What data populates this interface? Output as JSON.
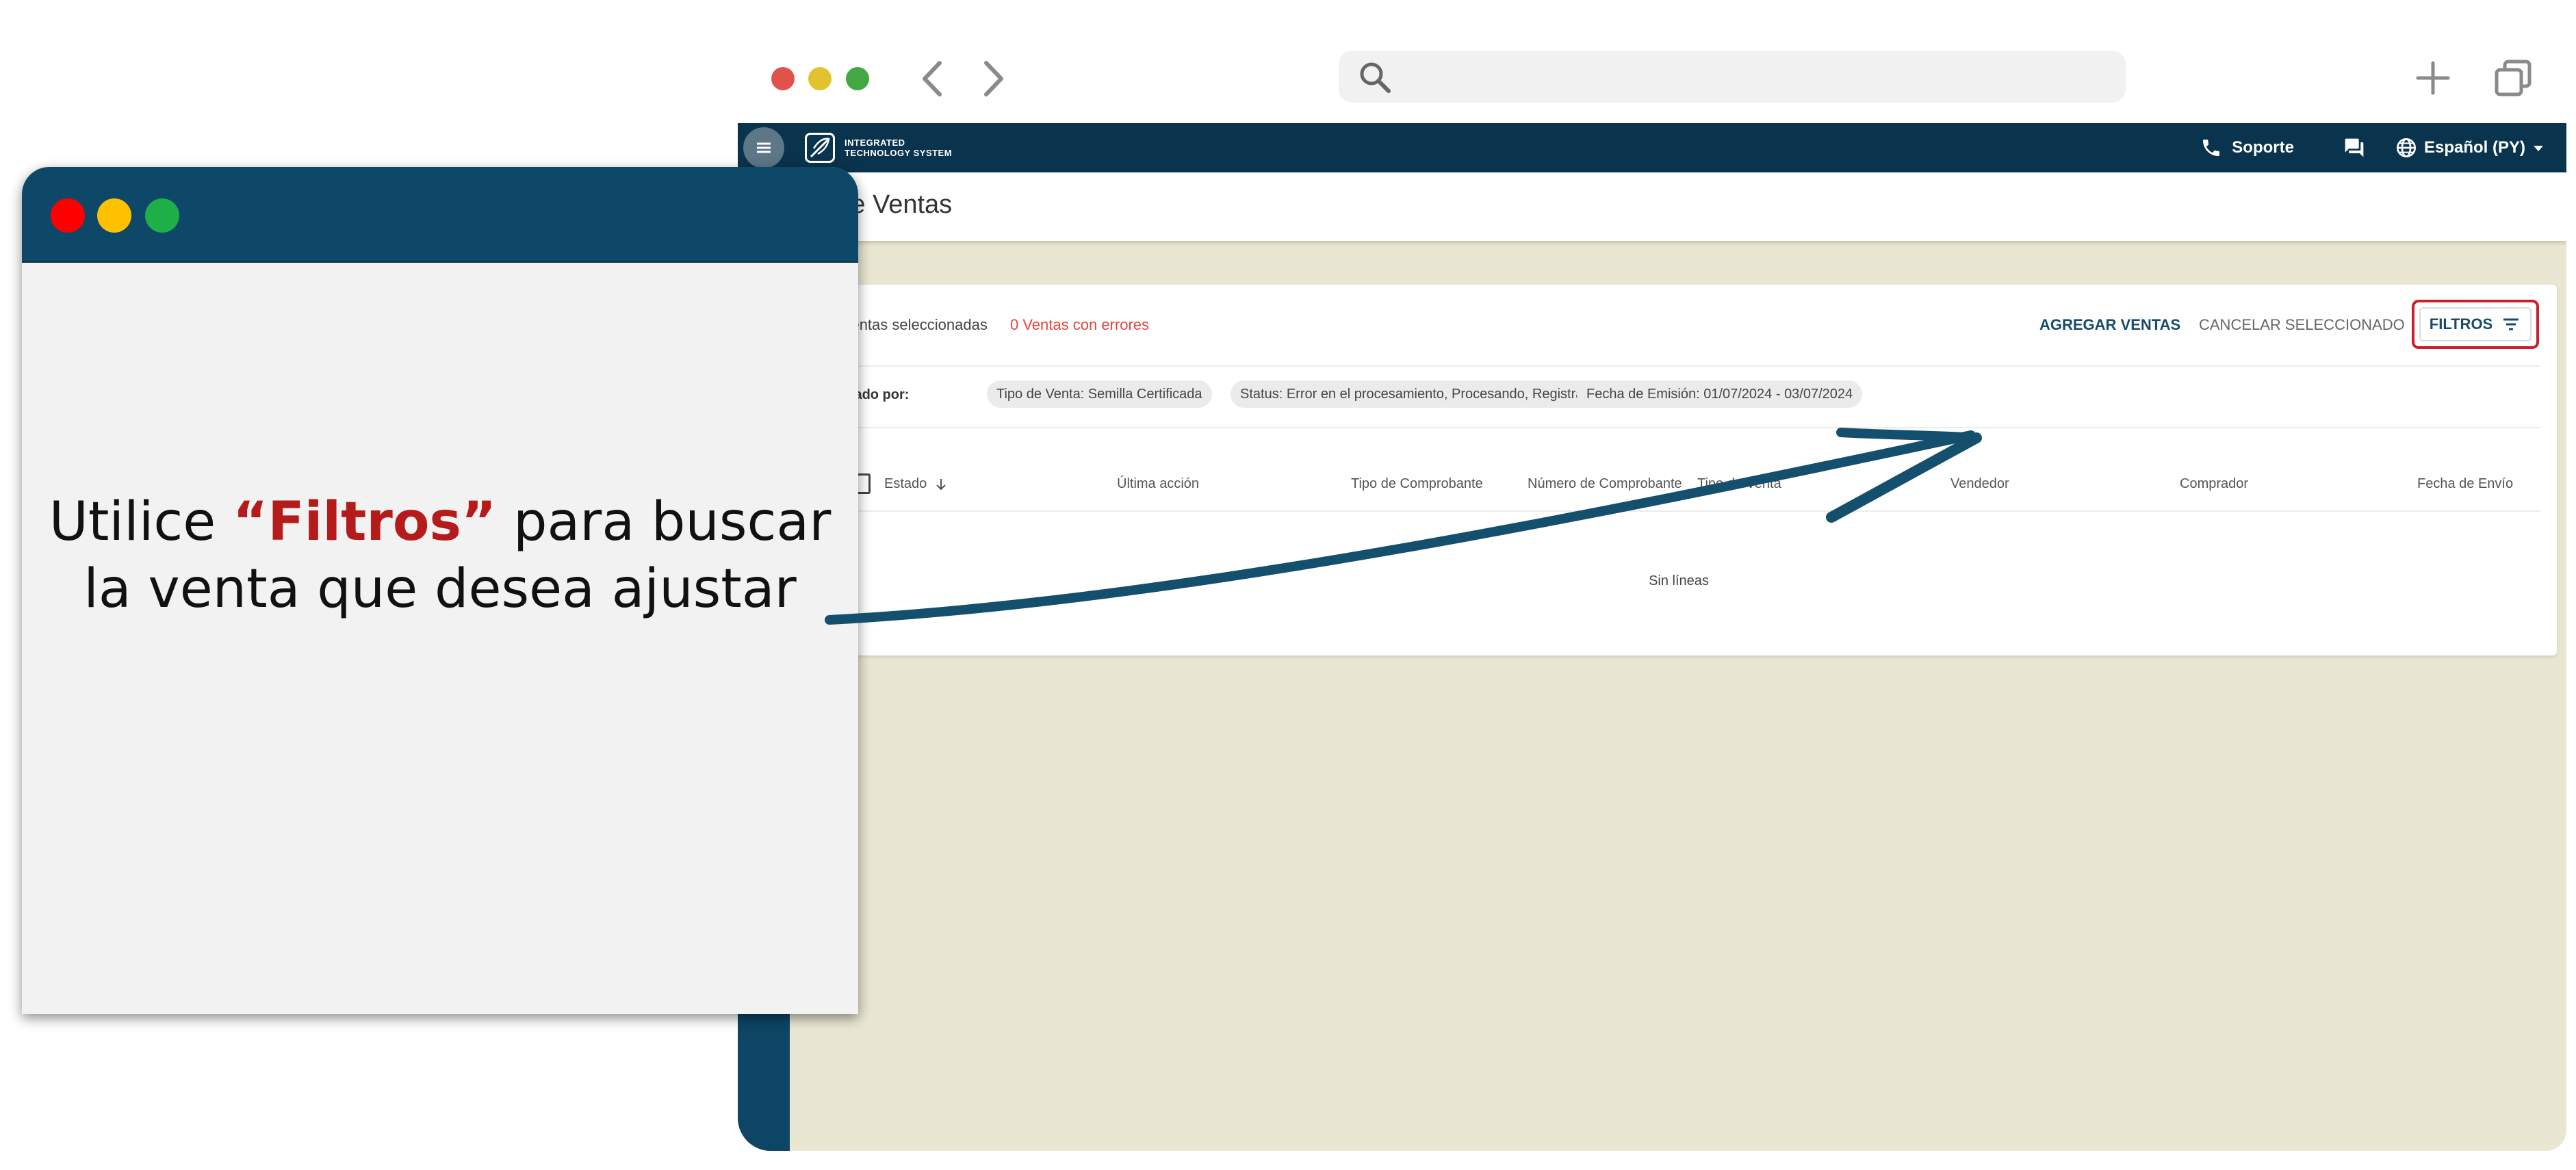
{
  "browser": {
    "address_value": "",
    "icons": [
      "back-arrow-icon",
      "forward-arrow-icon",
      "search-icon",
      "plus-icon",
      "tabs-icon"
    ]
  },
  "topbar": {
    "logo_line1": "INTEGRATED",
    "logo_line2": "TECHNOLOGY SYSTEM",
    "support_label": "Soporte",
    "language_label": "Español (PY)"
  },
  "page": {
    "title": "el de Ventas"
  },
  "card": {
    "selected_label": "Ventas seleccionadas",
    "errors_label": "0 Ventas con errores",
    "add_sales_label": "AGREGAR VENTAS",
    "cancel_selected_label": "CANCELAR SELECCIONADO",
    "filters_label": "FILTROS",
    "filtered_by_label": "trado por:",
    "chips": [
      "Tipo de Venta: Semilla Certificada",
      "Status: Error en el procesamiento, Procesando, Registrado, Esperando validación",
      "Fecha de Emisión: 01/07/2024 - 03/07/2024"
    ],
    "columns": {
      "estado": "Estado",
      "ultima_accion": "Última acción",
      "tipo_comprobante": "Tipo de Comprobante",
      "numero_comprobante": "Número de Comprobante",
      "tipo_venta": "Tipo de Venta",
      "vendedor": "Vendedor",
      "comprador": "Comprador",
      "fecha_envio": "Fecha de Envío"
    },
    "empty_message": "Sin líneas"
  },
  "callout": {
    "text_before": "Utilice ",
    "highlight": "“Filtros”",
    "text_after": " para buscar la venta que desea ajustar"
  },
  "colors": {
    "navbar": "#0a344d",
    "rail": "#0e4564",
    "background": "#e9e7d1",
    "accent_text": "#184a6b",
    "error": "#e2463b",
    "highlight_border": "#c8202b",
    "callout_highlight": "#b51b1b"
  }
}
